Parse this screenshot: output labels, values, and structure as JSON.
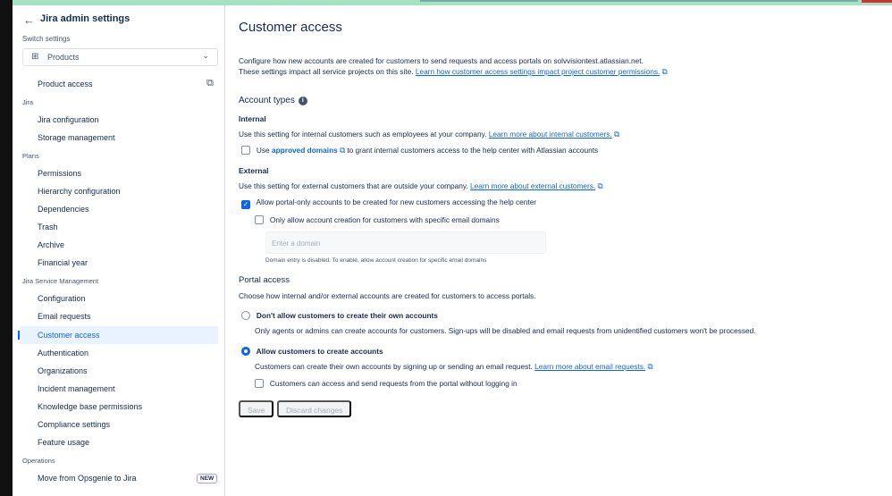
{
  "sidebar": {
    "title": "Jira admin settings",
    "switch_label": "Switch settings",
    "select_value": "Products",
    "product_access": "Product access",
    "sections": [
      {
        "label": "Jira",
        "items": [
          "Jira configuration",
          "Storage management"
        ]
      },
      {
        "label": "Plans",
        "items": [
          "Permissions",
          "Hierarchy configuration",
          "Dependencies",
          "Trash",
          "Archive",
          "Financial year"
        ]
      },
      {
        "label": "Jira Service Management",
        "items": [
          "Configuration",
          "Email requests",
          "Customer access",
          "Authentication",
          "Organizations",
          "Incident management",
          "Knowledge base permissions",
          "Compliance settings",
          "Feature usage"
        ]
      },
      {
        "label": "Operations",
        "items": [
          "Move from Opsgenie to Jira"
        ]
      }
    ],
    "new_badge": "NEW"
  },
  "main": {
    "title": "Customer access",
    "intro1": "Configure how new accounts are created for customers to send requests and access portals on solvvisiontest.atlassian.net.",
    "intro2": "These settings impact all service projects on this site.",
    "intro_link": "Learn how customer access settings impact project customer permissions.",
    "account_types": "Account types",
    "internal": {
      "heading": "Internal",
      "desc": "Use this setting for internal customers such as employees at your company.",
      "link": "Learn more about internal customers.",
      "cb_pre": "Use",
      "cb_link": "approved domains",
      "cb_post": "to grant internal customers access to the help center with Atlassian accounts",
      "checked": false
    },
    "external": {
      "heading": "External",
      "desc": "Use this setting for external customers that are outside your company.",
      "link": "Learn more about external customers.",
      "cb1": "Allow portal-only accounts to be created for new customers accessing the help center",
      "cb1_checked": true,
      "cb2": "Only allow account creation for customers with specific email domains",
      "cb2_checked": false,
      "domain_placeholder": "Enter a domain",
      "domain_help": "Domain entry is disabled. To enable, allow account creation for specific email domains"
    },
    "portal": {
      "heading": "Portal access",
      "desc": "Choose how internal and/or external accounts are created for customers to access portals.",
      "opt1": "Don't allow customers to create their own accounts",
      "opt1_desc": "Only agents or admins can create accounts for customers. Sign-ups will be disabled and email requests from unidentified customers won't be processed.",
      "opt2": "Allow customers to create accounts",
      "opt2_desc": "Customers can create their own accounts by signing up or sending an email request.",
      "opt2_link": "Learn more about email requests.",
      "selected": "opt2",
      "cb": "Customers can access and send requests from the portal without logging in",
      "cb_checked": false
    },
    "save": "Save",
    "discard": "Discard changes"
  }
}
